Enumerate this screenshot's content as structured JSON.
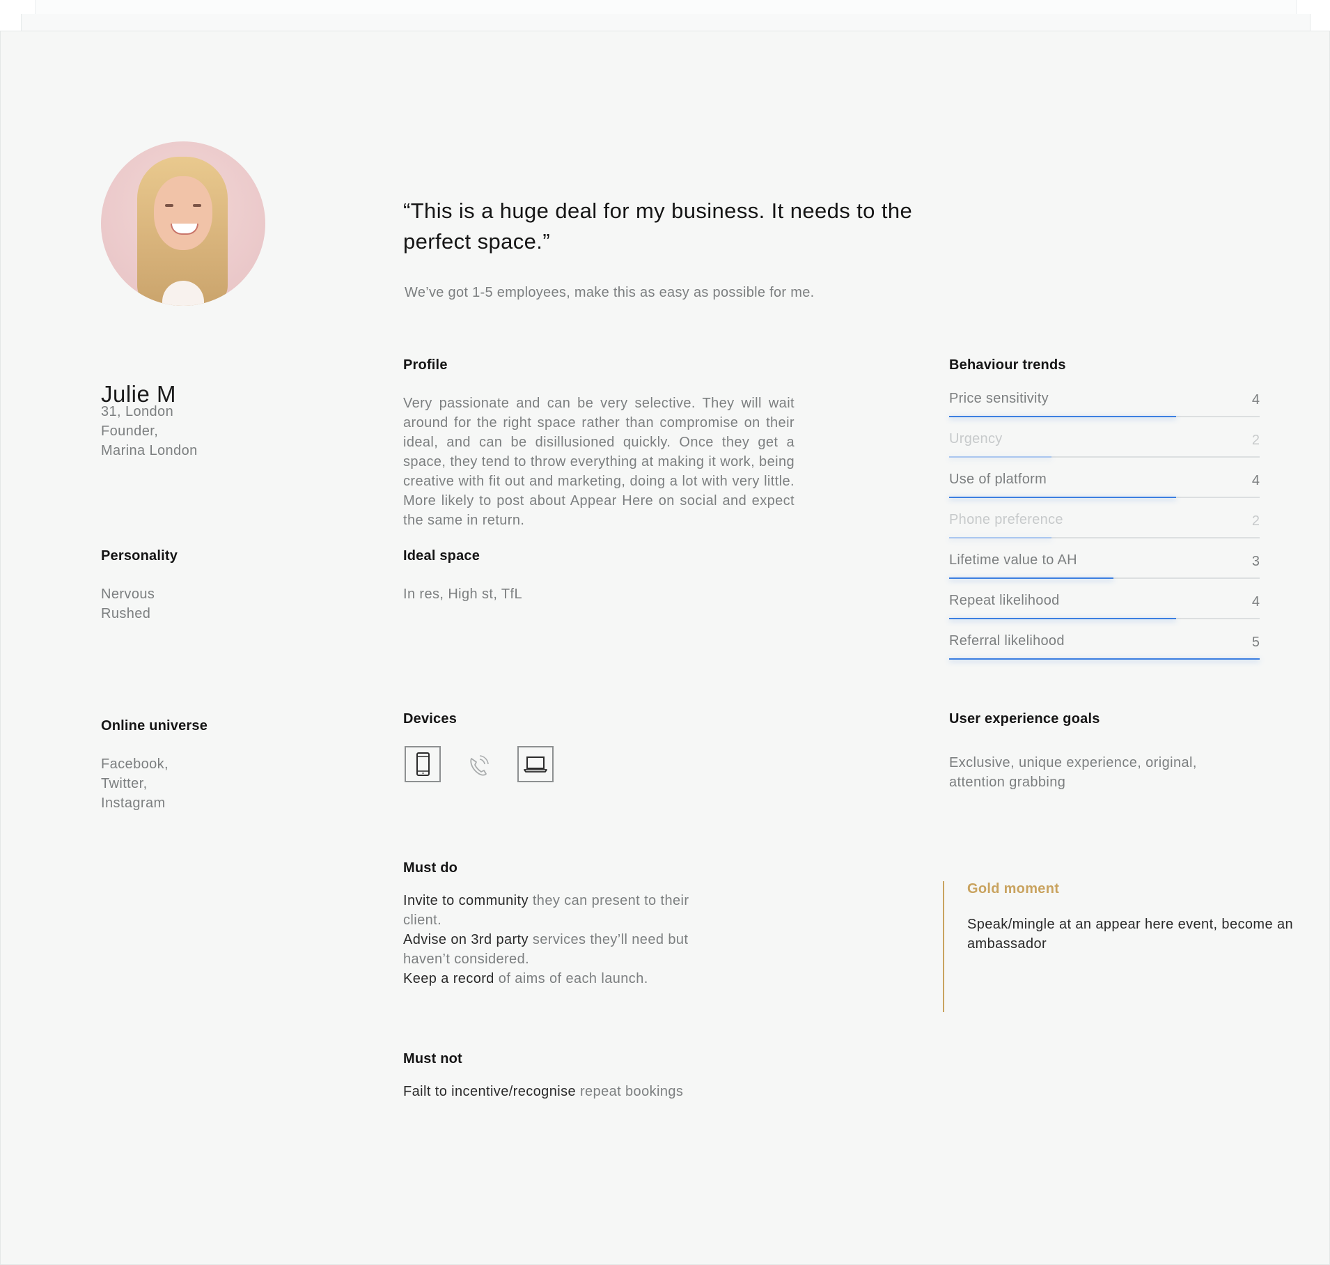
{
  "persona": {
    "name": "Julie M",
    "details": [
      "31, London",
      "Founder,",
      "Marina London"
    ]
  },
  "quote": {
    "text": "“This is a huge deal for my business.  It needs to the perfect space.”",
    "sub": "We’ve got 1-5 employees, make this as easy as possible for me."
  },
  "profile": {
    "heading": "Profile",
    "text": "Very passionate and can be very selective. They will wait around for the right space rather than compromise on their ideal, and can be disillusioned quickly. Once they get a space, they tend to throw everything at making it work, being creative with fit out and marketing, doing a lot with very little. More likely to post about Appear Here on social and expect the same in return."
  },
  "personality": {
    "heading": "Personality",
    "items": [
      "Nervous",
      "Rushed"
    ]
  },
  "ideal_space": {
    "heading": "Ideal space",
    "text": "In res, High st, TfL"
  },
  "online_universe": {
    "heading": "Online universe",
    "items": [
      "Facebook,",
      "Twitter,",
      "Instagram"
    ]
  },
  "devices": {
    "heading": "Devices",
    "items": [
      {
        "icon": "mobile-phone-icon",
        "active": true
      },
      {
        "icon": "telephone-icon",
        "active": false
      },
      {
        "icon": "laptop-icon",
        "active": true
      }
    ]
  },
  "behaviour_trends": {
    "heading": "Behaviour trends",
    "scale_max": 5,
    "items": [
      {
        "label": "Price sensitivity",
        "value": 4,
        "muted": false
      },
      {
        "label": "Urgency",
        "value": 2,
        "muted": true
      },
      {
        "label": "Use of platform",
        "value": 4,
        "muted": false
      },
      {
        "label": "Phone preference",
        "value": 2,
        "muted": true
      },
      {
        "label": "Lifetime value to AH",
        "value": 3,
        "muted": false
      },
      {
        "label": "Repeat likelihood",
        "value": 4,
        "muted": false
      },
      {
        "label": "Referral likelihood",
        "value": 5,
        "muted": false
      }
    ]
  },
  "ux_goals": {
    "heading": "User experience goals",
    "text": "Exclusive, unique experience, original, attention grabbing"
  },
  "must_do": {
    "heading": "Must do",
    "items": [
      {
        "strong": "Invite to community",
        "rest": " they can present to their client."
      },
      {
        "strong": "Advise on 3rd party",
        "rest": " services they’ll need but haven’t considered."
      },
      {
        "strong": "Keep a record",
        "rest": " of aims of each launch."
      }
    ]
  },
  "must_not": {
    "heading": "Must not",
    "strong": "Failt to incentive/recognise",
    "rest": " repeat bookings"
  },
  "gold_moment": {
    "heading": "Gold moment",
    "text": "Speak/mingle at an appear here event, become an ambassador",
    "color": "#c9a35f"
  },
  "colors": {
    "accent": "#3c7fe0",
    "gold": "#c9a35f",
    "background": "#f6f7f6"
  }
}
